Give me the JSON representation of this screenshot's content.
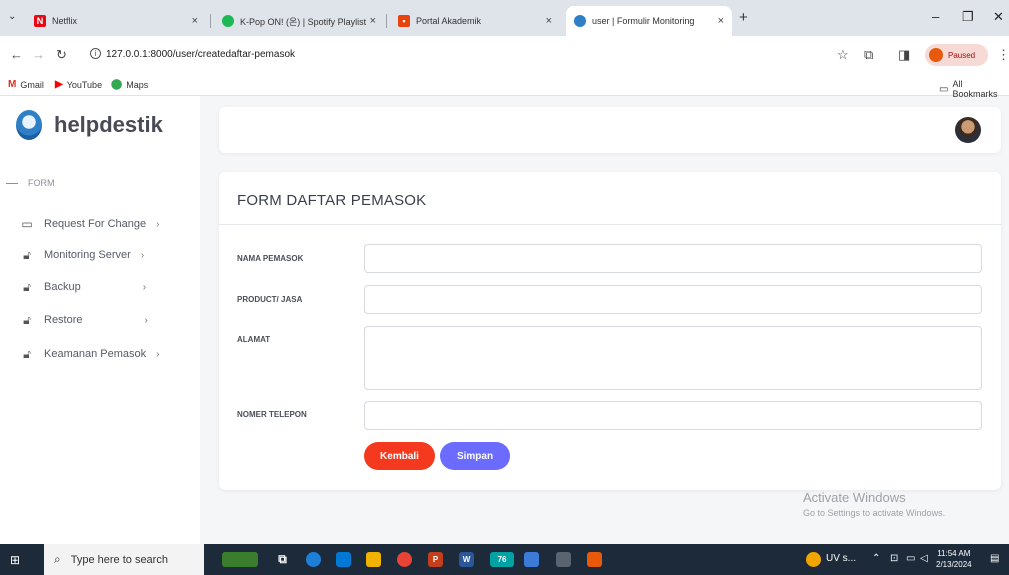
{
  "browser": {
    "tabs": [
      {
        "title": "Netflix",
        "close": "×"
      },
      {
        "title": "K-Pop ON! (온) | Spotify Playlist",
        "close": "×"
      },
      {
        "title": "Portal Akademik",
        "close": "×"
      },
      {
        "title": "user | Formulir Monitoring",
        "close": "×"
      }
    ],
    "new_tab": "+",
    "url": "127.0.0.1:8000/user/createdaftar-pemasok",
    "profile_status": "Paused",
    "bookmarks": [
      "Gmail",
      "YouTube",
      "Maps"
    ],
    "all_bookmarks": "All Bookmarks"
  },
  "sidebar": {
    "brand": "helpdestik",
    "section": "FORM",
    "items": [
      {
        "label": "Request For Change",
        "icon": "calendar-icon"
      },
      {
        "label": "Monitoring Server",
        "icon": "lock-icon"
      },
      {
        "label": "Backup",
        "icon": "lock-icon"
      },
      {
        "label": "Restore",
        "icon": "lock-icon"
      },
      {
        "label": "Keamanan Pemasok",
        "icon": "lock-icon"
      }
    ]
  },
  "form": {
    "title": "FORM DAFTAR PEMASOK",
    "fields": [
      {
        "label": "NAMA PEMASOK",
        "value": ""
      },
      {
        "label": "PRODUCT/ JASA",
        "value": ""
      },
      {
        "label": "ALAMAT",
        "value": ""
      },
      {
        "label": "NOMER TELEPON",
        "value": ""
      }
    ],
    "back_button": "Kembali",
    "save_button": "Simpan"
  },
  "watermark": {
    "line1": "Activate Windows",
    "line2": "Go to Settings to activate Windows."
  },
  "taskbar": {
    "search_placeholder": "Type here to search",
    "tray_app": "UV s...",
    "time": "11:54 AM",
    "date": "2/13/2024"
  },
  "colors": {
    "back_button": "#f5391e",
    "save_button": "#6b6bff",
    "taskbar": "#1c2a3a"
  }
}
